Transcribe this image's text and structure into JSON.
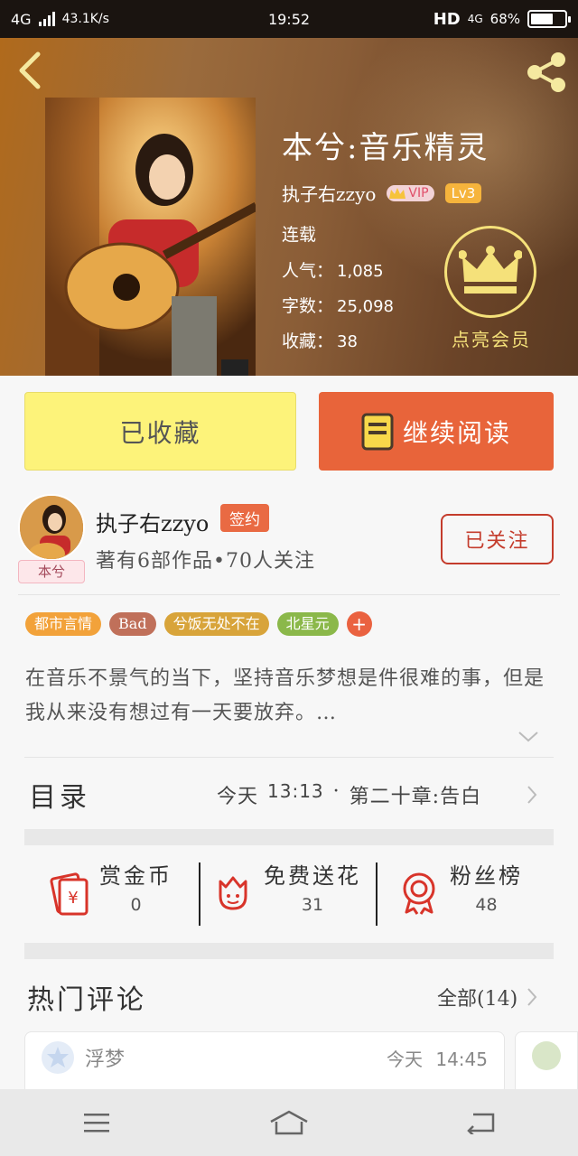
{
  "status_bar": {
    "network": "4G",
    "speed": "43.1K/s",
    "time": "19:52",
    "hd": "HD",
    "net_right": "4G",
    "battery": "68%",
    "battery_level": 0.68
  },
  "book": {
    "title": "本兮:音乐精灵",
    "author": "执子右zzyo",
    "vip_label": "VIP",
    "level": "Lv3",
    "status": "连载",
    "popularity_label": "人气：",
    "popularity": "1,085",
    "words_label": "字数：",
    "words": "25,098",
    "favorites_label": "收藏：",
    "favorites": "38",
    "member_label": "点亮会员"
  },
  "actions": {
    "collected_label": "已收藏",
    "continue_label": "继续阅读"
  },
  "author_card": {
    "name": "执子右zzyo",
    "badge": "签约",
    "subtitle": "著有6部作品•70人关注",
    "follow_label": "已关注",
    "avatar_tag": "本兮"
  },
  "tags": [
    {
      "label": "都市言情",
      "color": "#f2a23a"
    },
    {
      "label": "Bad",
      "color": "#c0705a"
    },
    {
      "label": "兮饭无处不在",
      "color": "#d8a43a"
    },
    {
      "label": "北星元",
      "color": "#8bb84a"
    }
  ],
  "tag_add": "+",
  "description": "在音乐不景气的当下，坚持音乐梦想是件很难的事，但是我从来没有想过有一天要放弃。…",
  "catalog": {
    "title": "目录",
    "day": "今天",
    "time": "13:13",
    "sep": "·",
    "chapter": "第二十章:告白"
  },
  "stats": [
    {
      "label": "赏金币",
      "value": "0",
      "icon": "red-envelope-icon"
    },
    {
      "label": "免费送花",
      "value": "31",
      "icon": "flower-icon"
    },
    {
      "label": "粉丝榜",
      "value": "48",
      "icon": "medal-icon"
    }
  ],
  "comments": {
    "title": "热门评论",
    "all_label": "全部(14)",
    "first": {
      "user": "浮梦",
      "day": "今天",
      "time": "14:45"
    }
  },
  "colors": {
    "accent_orange": "#e8643a",
    "collected_yellow": "#fdf37a",
    "follow_red": "#c43c2c",
    "member_gold": "#f5e17a"
  }
}
